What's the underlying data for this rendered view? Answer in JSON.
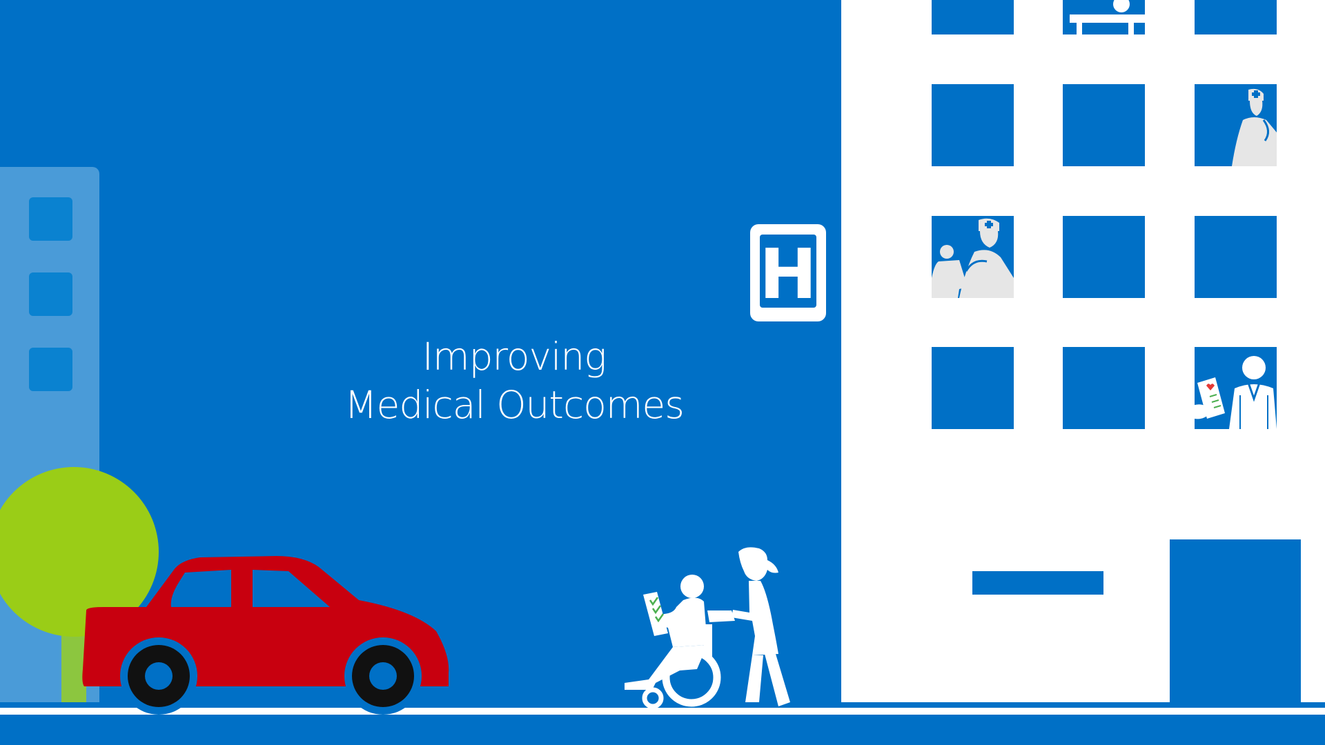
{
  "title": {
    "line1": "Improving",
    "line2": "Medical Outcomes"
  },
  "hospital_sign": {
    "letter": "H"
  },
  "colors": {
    "sky": "#0070c6",
    "building": "#ffffff",
    "background_building": "#4a9bd8",
    "tree": "#9acd17",
    "tree_trunk": "#8cc63f",
    "car": "#c8000f",
    "figures": "#ffffff",
    "figures_alt": "#e6e6e6",
    "checkmarks": "#4caf50",
    "heart": "#e53935"
  },
  "icons": [
    "hospital-sign-icon",
    "car-icon",
    "tree-icon",
    "wheelchair-patient-icon",
    "nurse-icon",
    "doctor-icon",
    "hospital-bed-icon",
    "clipboard-icon"
  ]
}
